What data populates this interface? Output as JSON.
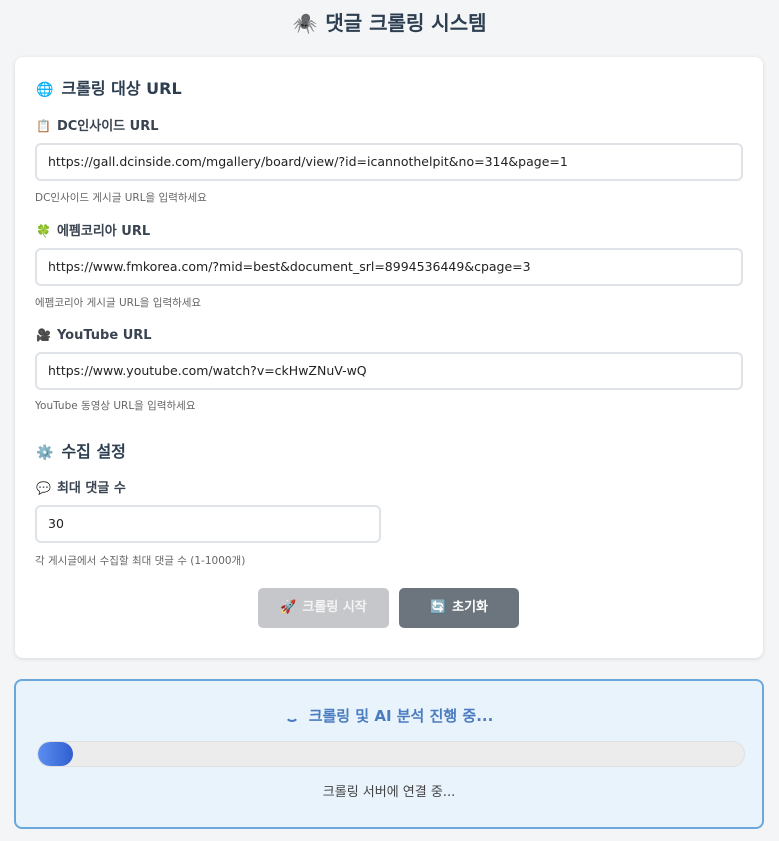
{
  "page": {
    "title_icon": "🕷️",
    "title": "댓글 크롤링 시스템"
  },
  "url_section": {
    "icon": "🌐",
    "heading": "크롤링 대상 URL",
    "dc": {
      "icon": "📋",
      "label": "DC인사이드 URL",
      "value": "https://gall.dcinside.com/mgallery/board/view/?id=icannothelpit&no=314&page=1",
      "hint": "DC인사이드 게시글 URL을 입력하세요"
    },
    "fm": {
      "icon": "🍀",
      "label": "에펨코리아 URL",
      "value": "https://www.fmkorea.com/?mid=best&document_srl=8994536449&cpage=3",
      "hint": "에펨코리아 게시글 URL을 입력하세요"
    },
    "yt": {
      "icon": "🎥",
      "label": "YouTube URL",
      "value": "https://www.youtube.com/watch?v=ckHwZNuV-wQ",
      "hint": "YouTube 동영상 URL을 입력하세요"
    }
  },
  "settings_section": {
    "icon": "⚙️",
    "heading": "수집 설정",
    "max_comments": {
      "icon": "💬",
      "label": "최대 댓글 수",
      "value": "30",
      "hint": "각 게시글에서 수집할 최대 댓글 수 (1-1000개)"
    }
  },
  "actions": {
    "start_icon": "🚀",
    "start_label": "크롤링 시작",
    "reset_icon": "🔄",
    "reset_label": "초기화"
  },
  "progress": {
    "title": "크롤링 및 AI 분석 진행 중...",
    "fraction": 0.05,
    "status": "크롤링 서버에 연결 중..."
  },
  "colors": {
    "accent": "#4a7cc0",
    "progress_border": "#6aa8dc",
    "start_button_disabled": "#c5c7ca",
    "reset_button": "#6c757d"
  }
}
